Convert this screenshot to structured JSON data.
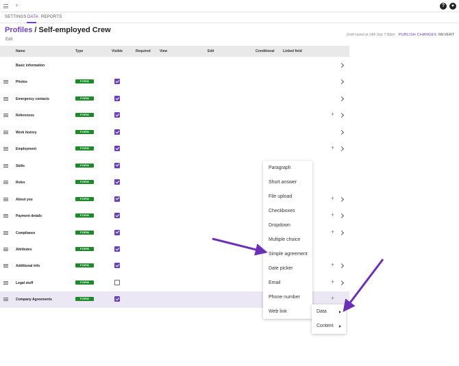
{
  "topbar": {
    "plus": "+",
    "help": "?",
    "bell": "●"
  },
  "tabs": [
    "SETTINGS",
    "DATA",
    "REPORTS"
  ],
  "header": {
    "crumb_link": "Profiles",
    "separator": " / ",
    "title": "Self-employed Crew",
    "edit": "Edit",
    "draft_note": "Draft saved at 14th Sep 7:30pm",
    "publish": "PUBLISH CHANGES",
    "revert": "REVERT"
  },
  "columns": {
    "name": "Name",
    "type": "Type",
    "visible": "Visible",
    "required": "Required",
    "view": "View",
    "edit": "Edit",
    "conditional": "Conditional",
    "linked": "Linked field"
  },
  "rows": [
    {
      "name": "Basic information",
      "badge": "",
      "visible": null,
      "plus": false,
      "chevron": true,
      "drag": false
    },
    {
      "name": "Photos",
      "badge": "FORM",
      "visible": true,
      "plus": false,
      "chevron": true,
      "drag": true
    },
    {
      "name": "Emergency contacts",
      "badge": "FORM",
      "visible": true,
      "plus": false,
      "chevron": true,
      "drag": true
    },
    {
      "name": "References",
      "badge": "FORM",
      "visible": true,
      "plus": true,
      "chevron": true,
      "drag": true
    },
    {
      "name": "Work history",
      "badge": "FORM",
      "visible": true,
      "plus": false,
      "chevron": true,
      "drag": true
    },
    {
      "name": "Employment",
      "badge": "FORM",
      "visible": true,
      "plus": true,
      "chevron": true,
      "drag": true
    },
    {
      "name": "Skills",
      "badge": "FORM",
      "visible": true,
      "plus": false,
      "chevron": false,
      "drag": true
    },
    {
      "name": "Roles",
      "badge": "FORM",
      "visible": true,
      "plus": false,
      "chevron": false,
      "drag": true
    },
    {
      "name": "About you",
      "badge": "FORM",
      "visible": true,
      "plus": true,
      "chevron": true,
      "drag": true
    },
    {
      "name": "Payment details",
      "badge": "FORM",
      "visible": true,
      "plus": true,
      "chevron": true,
      "drag": true
    },
    {
      "name": "Compliance",
      "badge": "FORM",
      "visible": true,
      "plus": true,
      "chevron": true,
      "drag": true
    },
    {
      "name": "Attributes",
      "badge": "FORM",
      "visible": true,
      "plus": false,
      "chevron": false,
      "drag": true
    },
    {
      "name": "Additional info",
      "badge": "FORM",
      "visible": true,
      "plus": true,
      "chevron": true,
      "drag": true
    },
    {
      "name": "Legal stuff",
      "badge": "FORM",
      "visible": false,
      "plus": true,
      "chevron": true,
      "drag": true
    },
    {
      "name": "Company Agreements",
      "badge": "FORM",
      "visible": true,
      "plus": true,
      "chevron": false,
      "drag": true,
      "highlight": true
    }
  ],
  "menu": [
    "Paragraph",
    "Short answer",
    "File upload",
    "Checkboxes",
    "Dropdown",
    "Multiple choice",
    "Simple agreement",
    "Date picker",
    "Email",
    "Phone number",
    "Web link"
  ],
  "submenu": [
    "Data",
    "Content"
  ],
  "colors": {
    "accent": "#6f3fcf",
    "badge": "#1d8a2a",
    "highlight": "#ece7f5",
    "arrow": "#6b2fb8"
  }
}
